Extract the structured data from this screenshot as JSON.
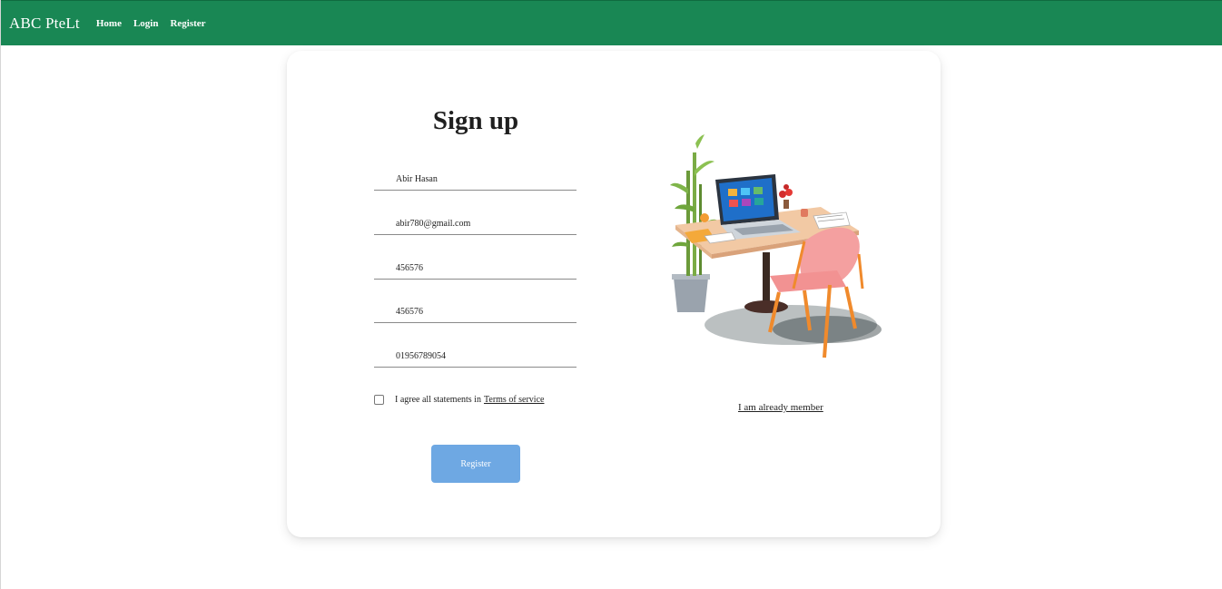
{
  "navbar": {
    "brand": "ABC PteLt",
    "links": [
      {
        "label": "Home"
      },
      {
        "label": "Login"
      },
      {
        "label": "Register"
      }
    ],
    "background_color": "#198754"
  },
  "signup": {
    "title": "Sign up",
    "fields": {
      "name": "Abir Hasan",
      "email": "abir780@gmail.com",
      "password": "456576",
      "confirm_password": "456576",
      "phone": "01956789054"
    },
    "agree_text": "I agree all statements in",
    "terms_link": "Terms of service",
    "register_button": "Register",
    "button_color": "#6ea8e3"
  },
  "side": {
    "illustration": "desk-laptop-chair-plant-illustration",
    "member_link": "I am already member"
  }
}
